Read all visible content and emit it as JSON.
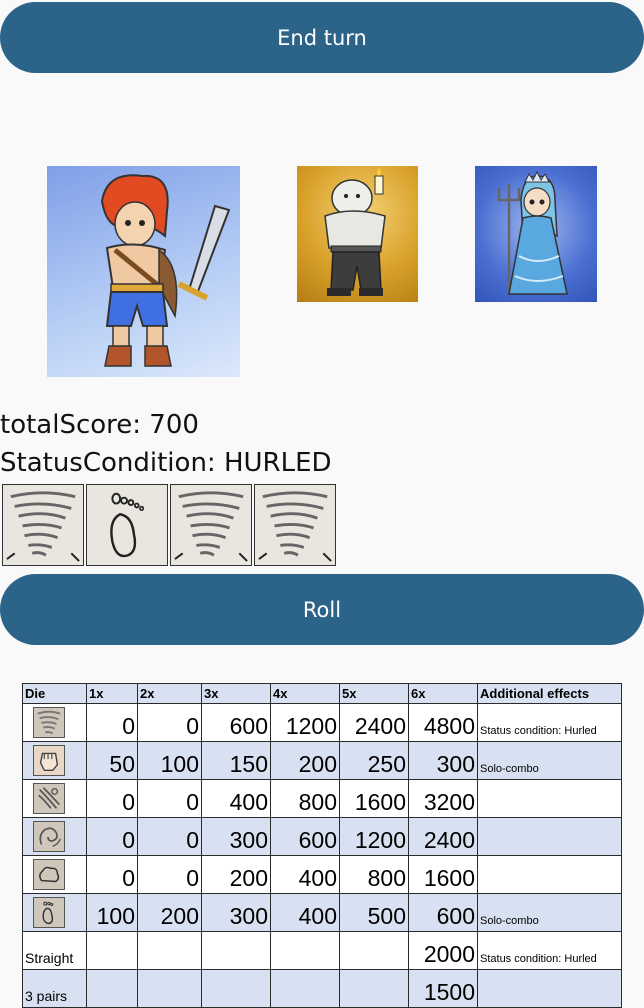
{
  "buttons": {
    "end_turn": "End turn",
    "roll": "Roll"
  },
  "characters": [
    {
      "name_icon": "red-haired-swordsman-icon"
    },
    {
      "name_icon": "pale-brute-with-candle-icon"
    },
    {
      "name_icon": "blue-haired-queen-with-trident-icon"
    }
  ],
  "stats": {
    "score_line": "totalScore: 700",
    "status_line": "StatusCondition: HURLED"
  },
  "current_dice": [
    {
      "icon": "tornado-icon"
    },
    {
      "icon": "footprint-icon"
    },
    {
      "icon": "tornado-icon"
    },
    {
      "icon": "tornado-icon"
    }
  ],
  "table": {
    "headers": [
      "Die",
      "1x",
      "2x",
      "3x",
      "4x",
      "5x",
      "6x",
      "Additional effects"
    ],
    "rows": [
      {
        "icon": "tornado-icon",
        "values": [
          "0",
          "0",
          "600",
          "1200",
          "2400",
          "4800"
        ],
        "effect": "Status condition: Hurled"
      },
      {
        "icon": "fist-icon",
        "values": [
          "50",
          "100",
          "150",
          "200",
          "250",
          "300"
        ],
        "effect": "Solo-combo"
      },
      {
        "icon": "wind-slash-icon",
        "values": [
          "0",
          "0",
          "400",
          "800",
          "1600",
          "3200"
        ],
        "effect": ""
      },
      {
        "icon": "swirl-icon",
        "values": [
          "0",
          "0",
          "300",
          "600",
          "1200",
          "2400"
        ],
        "effect": ""
      },
      {
        "icon": "cloud-icon",
        "values": [
          "0",
          "0",
          "200",
          "400",
          "800",
          "1600"
        ],
        "effect": ""
      },
      {
        "icon": "footprint-icon",
        "values": [
          "100",
          "200",
          "300",
          "400",
          "500",
          "600"
        ],
        "effect": "Solo-combo"
      },
      {
        "label": "Straight",
        "values": [
          "",
          "",
          "",
          "",
          "",
          "2000"
        ],
        "effect": "Status condition: Hurled"
      },
      {
        "label": "3 pairs",
        "values": [
          "",
          "",
          "",
          "",
          "",
          "1500"
        ],
        "effect": ""
      }
    ]
  },
  "colors": {
    "button": "#2b6389",
    "table_alt_row": "#d8e1f1"
  }
}
